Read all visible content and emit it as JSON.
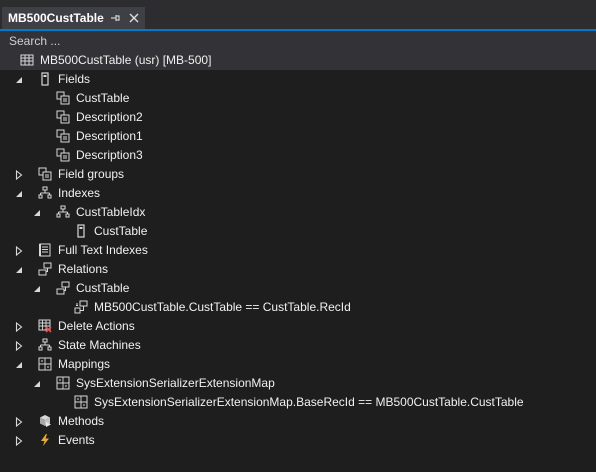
{
  "tab": {
    "title": "MB500CustTable",
    "pin_glyph": "⊣",
    "close_glyph": "✕"
  },
  "search": {
    "placeholder": "Search ..."
  },
  "tree": {
    "root": {
      "label": "MB500CustTable (usr) [MB-500]",
      "icon": "table-icon"
    },
    "fields": {
      "label": "Fields",
      "expanded": true,
      "icon": "fields-icon",
      "children": [
        {
          "label": "CustTable",
          "icon": "field-icon"
        },
        {
          "label": "Description2",
          "icon": "field-icon"
        },
        {
          "label": "Description1",
          "icon": "field-icon"
        },
        {
          "label": "Description3",
          "icon": "field-icon"
        }
      ]
    },
    "field_groups": {
      "label": "Field groups",
      "expanded": false,
      "icon": "field-groups-icon"
    },
    "indexes": {
      "label": "Indexes",
      "expanded": true,
      "icon": "indexes-icon",
      "index": {
        "label": "CustTableIdx",
        "expanded": true,
        "icon": "index-icon",
        "field": {
          "label": "CustTable",
          "icon": "index-field-icon"
        }
      }
    },
    "full_text_indexes": {
      "label": "Full Text Indexes",
      "expanded": false,
      "icon": "full-text-index-icon"
    },
    "relations": {
      "label": "Relations",
      "expanded": true,
      "icon": "relations-icon",
      "relation": {
        "label": "CustTable",
        "expanded": true,
        "icon": "relation-icon",
        "constraint": {
          "label": "MB500CustTable.CustTable == CustTable.RecId",
          "icon": "constraint-icon"
        }
      }
    },
    "delete_actions": {
      "label": "Delete Actions",
      "expanded": false,
      "icon": "delete-actions-icon"
    },
    "state_machines": {
      "label": "State Machines",
      "expanded": false,
      "icon": "state-machines-icon"
    },
    "mappings": {
      "label": "Mappings",
      "expanded": true,
      "icon": "mappings-icon",
      "mapping": {
        "label": "SysExtensionSerializerExtensionMap",
        "expanded": true,
        "icon": "mapping-icon",
        "field_mapping": {
          "label": "SysExtensionSerializerExtensionMap.BaseRecId == MB500CustTable.CustTable",
          "icon": "field-mapping-icon"
        }
      }
    },
    "methods": {
      "label": "Methods",
      "expanded": false,
      "icon": "methods-icon"
    },
    "events": {
      "label": "Events",
      "expanded": false,
      "icon": "events-icon"
    }
  },
  "colors": {
    "accent": "#007acc",
    "background": "#1e1e1e",
    "tab_bg": "#3f3f46",
    "search_bg": "#333337",
    "text": "#f1f1f1",
    "icon_gold": "#e8ab3a",
    "icon_red": "#e05050"
  }
}
